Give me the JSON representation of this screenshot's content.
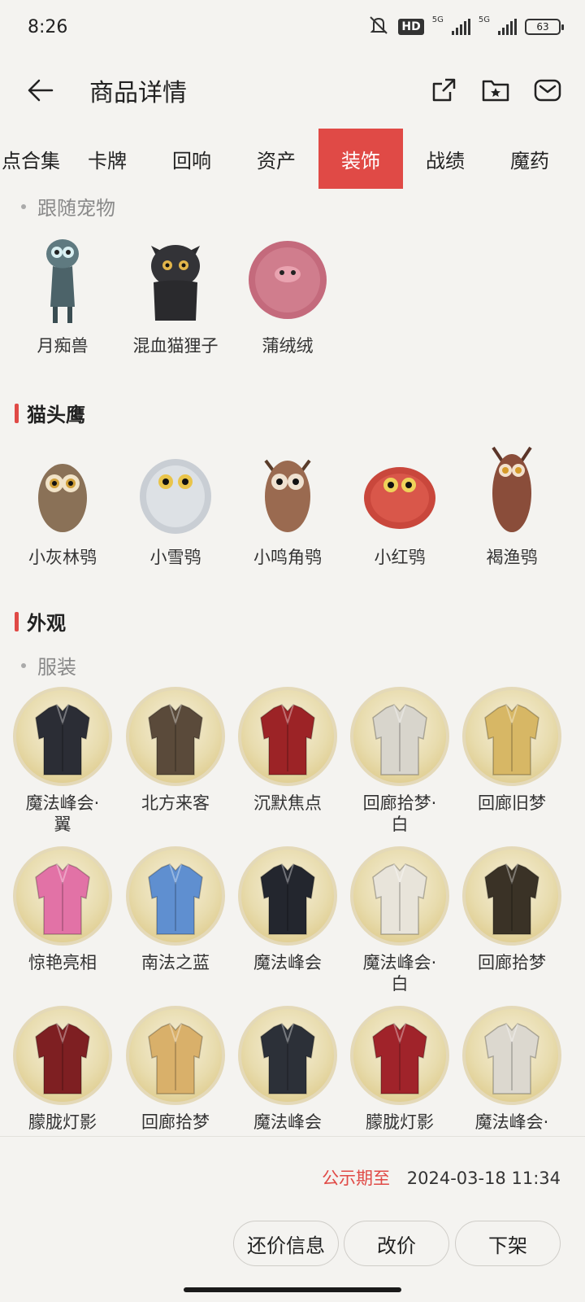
{
  "status": {
    "time": "8:26",
    "hd": "HD",
    "net1": "5G",
    "net2": "5G",
    "battery": "63"
  },
  "header": {
    "title": "商品详情",
    "icons": [
      "back-icon",
      "share-icon",
      "favorite-folder-icon",
      "message-icon"
    ]
  },
  "tabs": [
    {
      "label": "点合集"
    },
    {
      "label": "卡牌"
    },
    {
      "label": "回响"
    },
    {
      "label": "资产"
    },
    {
      "label": "装饰",
      "active": true
    },
    {
      "label": "战绩"
    },
    {
      "label": "魔药"
    }
  ],
  "pets": {
    "label": "跟随宠物",
    "items": [
      {
        "name": "月痴兽"
      },
      {
        "name": "混血猫狸子"
      },
      {
        "name": "蒲绒绒"
      }
    ]
  },
  "owls": {
    "title": "猫头鹰",
    "items": [
      {
        "name": "小灰林鸮"
      },
      {
        "name": "小雪鸮"
      },
      {
        "name": "小鸣角鸮"
      },
      {
        "name": "小红鸮"
      },
      {
        "name": "褐渔鸮"
      }
    ]
  },
  "appearance": {
    "title": "外观",
    "sub_label": "服装",
    "items": [
      {
        "line1": "魔法峰会·",
        "line2": "翼",
        "color": "#2b2d35"
      },
      {
        "line1": "北方来客",
        "line2": "",
        "color": "#5a4a3a"
      },
      {
        "line1": "沉默焦点",
        "line2": "",
        "color": "#9c2326"
      },
      {
        "line1": "回廊拾梦·",
        "line2": "白",
        "color": "#d8d5cc"
      },
      {
        "line1": "回廊旧梦",
        "line2": "",
        "color": "#d7b765"
      },
      {
        "line1": "惊艳亮相",
        "line2": "",
        "color": "#e272a6"
      },
      {
        "line1": "南法之蓝",
        "line2": "",
        "color": "#5f8fd0"
      },
      {
        "line1": "魔法峰会",
        "line2": "",
        "color": "#23262e"
      },
      {
        "line1": "魔法峰会·",
        "line2": "白",
        "color": "#e8e4da"
      },
      {
        "line1": "回廊拾梦",
        "line2": "",
        "color": "#3a3226"
      },
      {
        "line1": "朦胧灯影",
        "line2": "",
        "color": "#7e1f22"
      },
      {
        "line1": "回廊拾梦",
        "line2": "",
        "color": "#d9b06a"
      },
      {
        "line1": "魔法峰会",
        "line2": "",
        "color": "#2c3038"
      },
      {
        "line1": "朦胧灯影",
        "line2": "",
        "color": "#a0232a"
      },
      {
        "line1": "魔法峰会·",
        "line2": "",
        "color": "#dcd8cf"
      }
    ]
  },
  "footer": {
    "deadline_label": "公示期至",
    "deadline_value": "2024-03-18 11:34",
    "buttons": [
      "还价信息",
      "改价",
      "下架"
    ]
  },
  "colors": {
    "accent": "#e04a46",
    "background": "#f4f3f0"
  }
}
